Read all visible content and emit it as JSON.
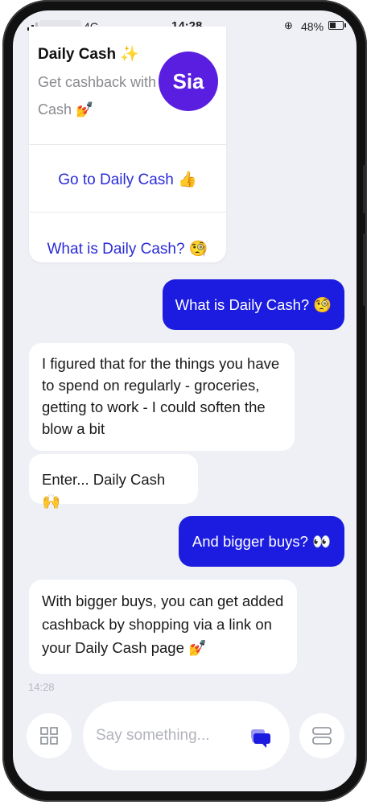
{
  "status_bar": {
    "network": "4G",
    "time": "14:28",
    "alarm_icon": "⊕",
    "battery": "48%"
  },
  "card": {
    "title": "Daily Cash ✨",
    "text": "Get cashback with Daily Cash 💅",
    "link_go": "Go to Daily Cash 👍",
    "link_what": "What is Daily Cash? 🧐"
  },
  "avatar": {
    "label": "Sia",
    "color": "#5a1ee0"
  },
  "messages": [
    {
      "from": "user",
      "text": "What is Daily Cash? 🧐"
    },
    {
      "from": "bot",
      "text": "I figured that for the things you have to spend on regularly - groceries, getting to work - I could soften the blow a bit"
    },
    {
      "from": "bot",
      "text": "Enter... Daily Cash 🙌"
    },
    {
      "from": "user",
      "text": "And bigger buys? 👀"
    },
    {
      "from": "bot",
      "text": "With bigger buys, you can get added cashback by shopping via a link on your Daily Cash page 💅"
    }
  ],
  "timestamp": "14:28",
  "composer": {
    "placeholder": "Say something...",
    "left_icon": "grid-icon",
    "send_icon": "chat-send-icon",
    "right_icon": "cards-icon"
  },
  "colors": {
    "user_bubble": "#1c1ce0",
    "link": "#2b2bd8",
    "background": "#eef0f5"
  }
}
